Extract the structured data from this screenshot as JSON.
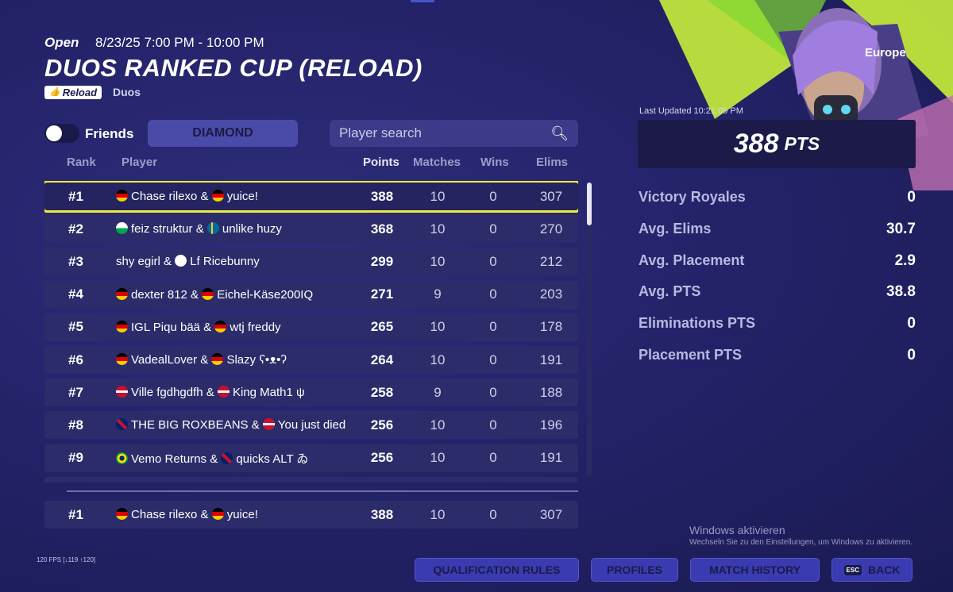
{
  "event": {
    "status": "Open",
    "date_range": "8/23/25 7:00 PM - 10:00 PM",
    "title": "DUOS RANKED CUP (RELOAD)",
    "mode_badge": "Reload",
    "mode_type": "Duos"
  },
  "controls": {
    "friends_label": "Friends",
    "friends_toggle_on": false,
    "rank_tab": "DIAMOND",
    "search_placeholder": "Player search"
  },
  "columns": {
    "rank": "Rank",
    "player": "Player",
    "points": "Points",
    "matches": "Matches",
    "wins": "Wins",
    "elims": "Elims"
  },
  "leaderboard": [
    {
      "rank": "#1",
      "f1": "de",
      "p1": "Chase rilexo",
      "f2": "de",
      "p2": "yuice!",
      "points": "388",
      "matches": "10",
      "wins": "0",
      "elims": "307"
    },
    {
      "rank": "#2",
      "f1": "wa",
      "p1": "feiz struktur",
      "f2": "se",
      "p2": "unlike huzy",
      "points": "368",
      "matches": "10",
      "wins": "0",
      "elims": "270"
    },
    {
      "rank": "#3",
      "f1": "",
      "p1": "shy egirl",
      "f2": "en",
      "p2": "Lf Ricebunny",
      "points": "299",
      "matches": "10",
      "wins": "0",
      "elims": "212"
    },
    {
      "rank": "#4",
      "f1": "de",
      "p1": "dexter 812",
      "f2": "de",
      "p2": "Eichel-Käse200IQ",
      "points": "271",
      "matches": "9",
      "wins": "0",
      "elims": "203"
    },
    {
      "rank": "#5",
      "f1": "de",
      "p1": "IGL Piqu bää",
      "f2": "de",
      "p2": "wtj freddy",
      "points": "265",
      "matches": "10",
      "wins": "0",
      "elims": "178"
    },
    {
      "rank": "#6",
      "f1": "de",
      "p1": "VadealLover",
      "f2": "de",
      "p2": "Slazy ʕ•ᴥ•ʔ",
      "points": "264",
      "matches": "10",
      "wins": "0",
      "elims": "191"
    },
    {
      "rank": "#7",
      "f1": "dk",
      "p1": "Ville fgdhgdfh",
      "f2": "dk",
      "p2": "King Math1 ψ",
      "points": "258",
      "matches": "9",
      "wins": "0",
      "elims": "188"
    },
    {
      "rank": "#8",
      "f1": "gb",
      "p1": "THE BIG ROXBEANS",
      "f2": "dk",
      "p2": "You just died",
      "points": "256",
      "matches": "10",
      "wins": "0",
      "elims": "196"
    },
    {
      "rank": "#9",
      "f1": "br",
      "p1": "Vemo Returns",
      "f2": "gb",
      "p2": "quicks ALT ゐ",
      "points": "256",
      "matches": "10",
      "wins": "0",
      "elims": "191"
    }
  ],
  "my_row": {
    "rank": "#1",
    "f1": "de",
    "p1": "Chase rilexo",
    "f2": "de",
    "p2": "yuice!",
    "points": "388",
    "matches": "10",
    "wins": "0",
    "elims": "307"
  },
  "summary": {
    "region": "Europe",
    "last_updated": "Last Updated 10:21:09 PM",
    "points": "388",
    "points_unit": "PTS",
    "stats": [
      {
        "label": "Victory Royales",
        "value": "0"
      },
      {
        "label": "Avg. Elims",
        "value": "30.7"
      },
      {
        "label": "Avg. Placement",
        "value": "2.9"
      },
      {
        "label": "Avg. PTS",
        "value": "38.8"
      },
      {
        "label": "Eliminations PTS",
        "value": "0"
      },
      {
        "label": "Placement PTS",
        "value": "0"
      }
    ]
  },
  "footer": {
    "fps": "120 FPS [↓119 ↑120]",
    "windows_title": "Windows aktivieren",
    "windows_sub": "Wechseln Sie zu den Einstellungen, um Windows zu aktivieren.",
    "qualification_rules": "QUALIFICATION RULES",
    "profiles": "PROFILES",
    "match_history": "MATCH HISTORY",
    "back": "BACK",
    "back_key": "ESC"
  },
  "colors": {
    "accent_green": "#c8f03a",
    "selected_outline": "#f0ec3a",
    "button_bg": "#3a3bb0"
  }
}
